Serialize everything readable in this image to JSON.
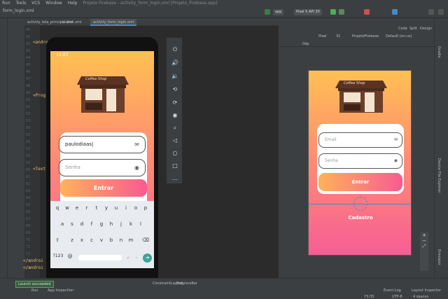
{
  "menubar": {
    "items": [
      "Run",
      "Tools",
      "VCS",
      "Window",
      "Help"
    ],
    "title": "Projeto Firebase - activity_form_login.xml [Projeto_Firebase.app]"
  },
  "toolbar": {
    "breadcrumb": "form_login.xml",
    "run_config": "app",
    "device": "Pixel 5 API 30"
  },
  "tabs": [
    "activity_tela_principal.xml",
    "button.xml",
    "activity_form_login.xml"
  ],
  "gutter": {
    "lines": [
      "40",
      "41",
      "42",
      "43",
      "44",
      "45",
      "46",
      "47",
      "48",
      "49",
      "50",
      "51",
      "52",
      "53",
      "54",
      "55",
      "56",
      "57",
      "58",
      "59",
      "60",
      "61",
      "62",
      "63",
      "64",
      "65",
      "66",
      "67",
      "68",
      "69",
      "70",
      "71",
      "72",
      "73",
      "74"
    ]
  },
  "code": {
    "line1": "<andro",
    "line2": "<Progr",
    "line3": "<Text",
    "line4": "</androi",
    "line5": "</androi"
  },
  "emulator": {
    "time": "11:07",
    "email_value": "paulodiaas|",
    "password_placeholder": "Senha",
    "enter_label": "Entrar",
    "shop_sign": "Coffee Shop",
    "keys_row1": [
      "q",
      "w",
      "e",
      "r",
      "t",
      "y",
      "u",
      "i",
      "o",
      "p"
    ],
    "keys_row2": [
      "a",
      "s",
      "d",
      "f",
      "g",
      "h",
      "j",
      "k",
      "l"
    ],
    "keys_row3": [
      "z",
      "x",
      "c",
      "v",
      "b",
      "n",
      "m"
    ],
    "keys_row4": {
      "sym": "?123",
      "at": "@",
      "comma": ",",
      "period": "."
    }
  },
  "design": {
    "toolbar1": {
      "code": "Code",
      "split": "Split",
      "design": "Design"
    },
    "toolbar2": {
      "device": "Pixel",
      "api": "31",
      "project": "ProjetoFirebase",
      "locale": "Default (en-us)",
      "zoom": "0dp"
    },
    "email_placeholder": "Email",
    "password_placeholder": "Senha",
    "enter_label": "Entrar",
    "cadastro_label": "Cadastro",
    "shop_sign": "Coffee Shop"
  },
  "rightstrip": {
    "labels": [
      "Gradle",
      "Device File Explorer",
      "Emulator"
    ]
  },
  "bottombar": {
    "left": "Launch succeeded",
    "crumbs": [
      "ConstraintLayout",
      "ProgressBar"
    ],
    "run": "Run",
    "app_inspection": "App Inspection",
    "event_log": "Event Log",
    "layout_inspector": "Layout Inspector",
    "position": "73:35",
    "encoding": "UTF-8",
    "indent": "4 spaces"
  }
}
